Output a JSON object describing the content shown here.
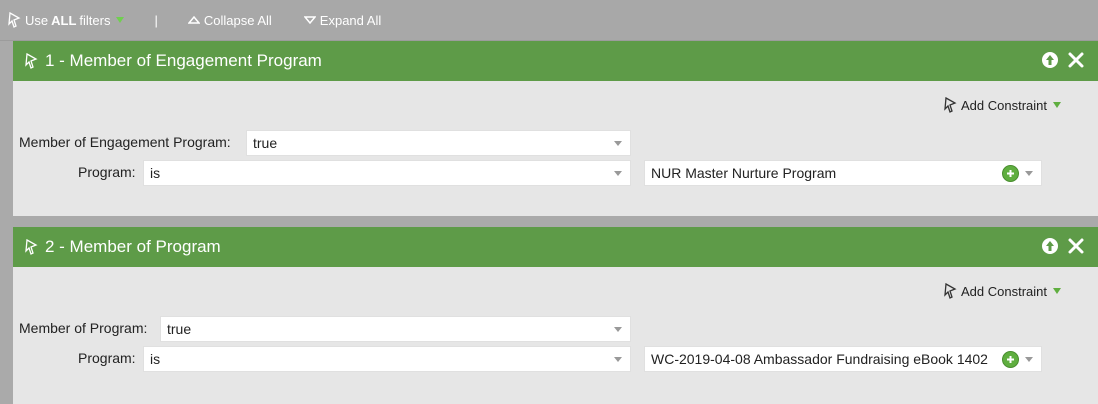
{
  "toolbar": {
    "use_prefix": "Use",
    "use_bold": "ALL",
    "use_suffix": "filters",
    "separator": "|",
    "collapse_label": "Collapse All",
    "expand_label": "Expand All"
  },
  "filters": [
    {
      "title": "1 - Member of Engagement Program",
      "add_constraint": "Add Constraint",
      "field_label": "Member of Engagement Program:",
      "field_value": "true",
      "program_label": "Program:",
      "operator_value": "is",
      "program_value": "NUR Master Nurture Program"
    },
    {
      "title": "2 - Member of Program",
      "add_constraint": "Add Constraint",
      "field_label": "Member of Program:",
      "field_value": "true",
      "program_label": "Program:",
      "operator_value": "is",
      "program_value": "WC-2019-04-08 Ambassador Fundraising eBook 1402"
    }
  ],
  "colors": {
    "header_green": "#5e9b48",
    "panel_bg": "#e6e6e6",
    "toolbar_bg": "#a8a8a8",
    "plus_green": "#5fae3f"
  },
  "icons": [
    "filter-wand-icon",
    "chevron-down-icon",
    "collapse-icon",
    "expand-icon",
    "move-up-icon",
    "close-icon",
    "add-icon"
  ]
}
